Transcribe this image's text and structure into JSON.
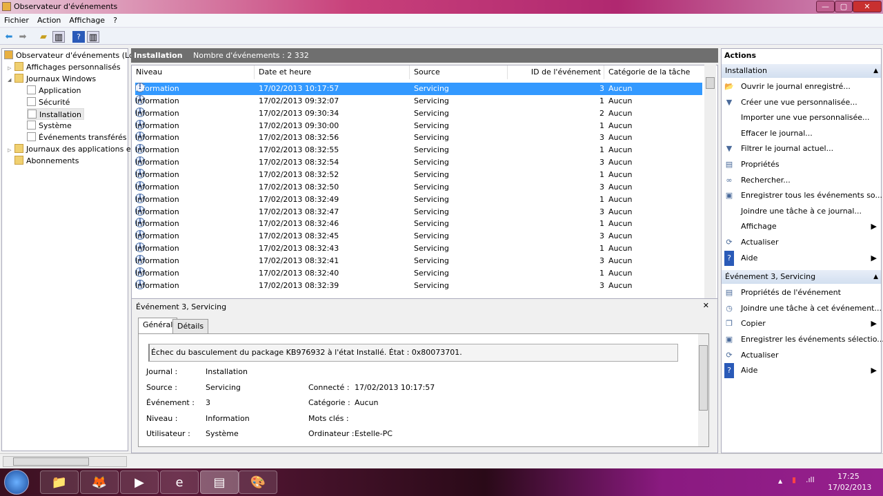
{
  "window": {
    "title": "Observateur d'événements",
    "min": "—",
    "max": "▢",
    "close": "✕"
  },
  "menu": [
    "Fichier",
    "Action",
    "Affichage",
    "?"
  ],
  "tree": {
    "root": "Observateur d'événements (Local)",
    "items": [
      {
        "label": "Affichages personnalisés",
        "level": 1,
        "expander": "▷"
      },
      {
        "label": "Journaux Windows",
        "level": 1,
        "expander": "◢"
      },
      {
        "label": "Application",
        "level": 2
      },
      {
        "label": "Sécurité",
        "level": 2
      },
      {
        "label": "Installation",
        "level": 2,
        "selected": true
      },
      {
        "label": "Système",
        "level": 2
      },
      {
        "label": "Événements transférés",
        "level": 2
      },
      {
        "label": "Journaux des applications et",
        "level": 1,
        "expander": "▷"
      },
      {
        "label": "Abonnements",
        "level": 1
      }
    ]
  },
  "list": {
    "title": "Installation",
    "count_label": "Nombre d'événements : 2 332",
    "columns": [
      "Niveau",
      "Date et heure",
      "Source",
      "ID de l'événement",
      "Catégorie de la tâche"
    ],
    "rows": [
      [
        "Information",
        "17/02/2013 10:17:57",
        "Servicing",
        "3",
        "Aucun"
      ],
      [
        "Information",
        "17/02/2013 09:32:07",
        "Servicing",
        "1",
        "Aucun"
      ],
      [
        "Information",
        "17/02/2013 09:30:34",
        "Servicing",
        "2",
        "Aucun"
      ],
      [
        "Information",
        "17/02/2013 09:30:00",
        "Servicing",
        "1",
        "Aucun"
      ],
      [
        "Information",
        "17/02/2013 08:32:56",
        "Servicing",
        "3",
        "Aucun"
      ],
      [
        "Information",
        "17/02/2013 08:32:55",
        "Servicing",
        "1",
        "Aucun"
      ],
      [
        "Information",
        "17/02/2013 08:32:54",
        "Servicing",
        "3",
        "Aucun"
      ],
      [
        "Information",
        "17/02/2013 08:32:52",
        "Servicing",
        "1",
        "Aucun"
      ],
      [
        "Information",
        "17/02/2013 08:32:50",
        "Servicing",
        "3",
        "Aucun"
      ],
      [
        "Information",
        "17/02/2013 08:32:49",
        "Servicing",
        "1",
        "Aucun"
      ],
      [
        "Information",
        "17/02/2013 08:32:47",
        "Servicing",
        "3",
        "Aucun"
      ],
      [
        "Information",
        "17/02/2013 08:32:46",
        "Servicing",
        "1",
        "Aucun"
      ],
      [
        "Information",
        "17/02/2013 08:32:45",
        "Servicing",
        "3",
        "Aucun"
      ],
      [
        "Information",
        "17/02/2013 08:32:43",
        "Servicing",
        "1",
        "Aucun"
      ],
      [
        "Information",
        "17/02/2013 08:32:41",
        "Servicing",
        "3",
        "Aucun"
      ],
      [
        "Information",
        "17/02/2013 08:32:40",
        "Servicing",
        "1",
        "Aucun"
      ],
      [
        "Information",
        "17/02/2013 08:32:39",
        "Servicing",
        "3",
        "Aucun"
      ]
    ]
  },
  "detail": {
    "title": "Événement 3, Servicing",
    "close": "✕",
    "tabs": [
      "Général",
      "Détails"
    ],
    "message": "Échec du basculement du package KB976932 à l'état Installé. État : 0x80073701.",
    "left": [
      [
        "Journal :",
        "Installation"
      ],
      [
        "Source :",
        "Servicing"
      ],
      [
        "Événement :",
        "3"
      ],
      [
        "Niveau :",
        "Information"
      ],
      [
        "Utilisateur :",
        "Système"
      ]
    ],
    "right": [
      [
        "Connecté :",
        "17/02/2013 10:17:57"
      ],
      [
        "Catégorie :",
        "Aucun"
      ],
      [
        "Mots clés :",
        ""
      ],
      [
        "Ordinateur :",
        "Estelle-PC"
      ]
    ]
  },
  "actions": {
    "title": "Actions",
    "sections": [
      {
        "title": "Installation",
        "items": [
          {
            "label": "Ouvrir le journal enregistré...",
            "icon": "folder-open-icon",
            "glyph": "📂"
          },
          {
            "label": "Créer une vue personnalisée...",
            "icon": "filter-icon",
            "glyph": "▼"
          },
          {
            "label": "Importer une vue personnalisée...",
            "icon": "",
            "glyph": ""
          },
          {
            "label": "Effacer le journal...",
            "icon": "",
            "glyph": ""
          },
          {
            "label": "Filtrer le journal actuel...",
            "icon": "filter-icon",
            "glyph": "▼"
          },
          {
            "label": "Propriétés",
            "icon": "properties-icon",
            "glyph": "▤"
          },
          {
            "label": "Rechercher...",
            "icon": "binoculars-icon",
            "glyph": "∞"
          },
          {
            "label": "Enregistrer tous les événements so...",
            "icon": "save-icon",
            "glyph": "▣"
          },
          {
            "label": "Joindre une tâche à ce journal...",
            "icon": "",
            "glyph": ""
          },
          {
            "label": "Affichage",
            "icon": "",
            "glyph": "",
            "submenu": true
          },
          {
            "label": "Actualiser",
            "icon": "refresh-icon",
            "glyph": "⟳"
          },
          {
            "label": "Aide",
            "icon": "help-icon",
            "glyph": "?",
            "submenu": true
          }
        ]
      },
      {
        "title": "Événement 3, Servicing",
        "items": [
          {
            "label": "Propriétés de l'événement",
            "icon": "properties-icon",
            "glyph": "▤"
          },
          {
            "label": "Joindre une tâche à cet événement...",
            "icon": "task-icon",
            "glyph": "◷"
          },
          {
            "label": "Copier",
            "icon": "copy-icon",
            "glyph": "❐",
            "submenu": true
          },
          {
            "label": "Enregistrer les événements sélectio...",
            "icon": "save-icon",
            "glyph": "▣"
          },
          {
            "label": "Actualiser",
            "icon": "refresh-icon",
            "glyph": "⟳"
          },
          {
            "label": "Aide",
            "icon": "help-icon",
            "glyph": "?",
            "submenu": true
          }
        ]
      }
    ]
  },
  "tray": {
    "time": "17:25",
    "date": "17/02/2013"
  },
  "colors": {
    "selection": "#3399ff",
    "header_bar": "#6f6f6f",
    "taskbar": "#96208e"
  }
}
